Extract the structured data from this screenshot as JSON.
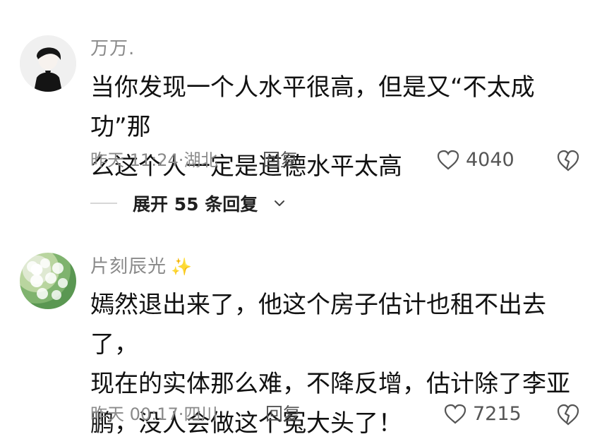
{
  "comments": [
    {
      "username": "万万.",
      "text": "当你发现一个人水平很高，但是又“不太成功”那\n么这个人一定是道德水平太高",
      "time": "昨天 11:24",
      "location": "湖北",
      "reply_label": "回复",
      "likes": "4040",
      "expand_label": "展开 55 条回复",
      "avatar": "person-avatar",
      "like_icon": "heart-icon",
      "dislike_icon": "broken-heart-icon"
    },
    {
      "username": "片刻辰光",
      "username_emoji": "✨",
      "text": "嫣然退出来了，他这个房子估计也租不出去了，\n现在的实体那么难，不降反增，估计除了李亚\n鹏，没人会做这个冤大头了！",
      "time": "昨天 00:17",
      "location": "四川",
      "reply_label": "回复",
      "likes": "7215",
      "avatar": "flower-avatar",
      "like_icon": "heart-icon",
      "dislike_icon": "broken-heart-icon"
    }
  ],
  "colors": {
    "meta": "#8a8a8a",
    "text": "#111111",
    "icon": "#555555",
    "divider": "#d7d7d7",
    "sparkle": "#f0c74f"
  }
}
